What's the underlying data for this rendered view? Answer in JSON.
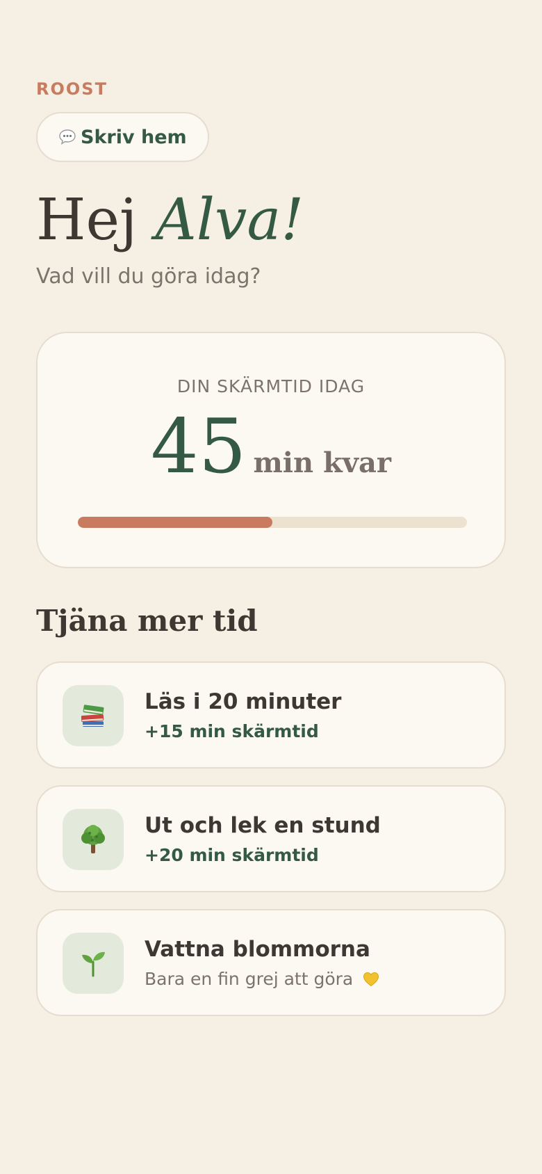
{
  "brand": "ROOST",
  "header": {
    "write_home_label": "Skriv hem"
  },
  "greeting": {
    "hello": "Hej",
    "name": "Alva!",
    "subtitle": "Vad vill du göra idag?"
  },
  "screen_time": {
    "label": "DIN SKÄRMTID IDAG",
    "value": "45",
    "unit": "min kvar",
    "progress_percent": 50
  },
  "earn": {
    "title": "Tjäna mer tid",
    "tasks": [
      {
        "icon": "books-icon",
        "title": "Läs i 20 minuter",
        "subtitle": "+15 min skärmtid"
      },
      {
        "icon": "tree-icon",
        "title": "Ut och lek en stund",
        "subtitle": "+20 min skärmtid"
      },
      {
        "icon": "seedling-icon",
        "title": "Vattna blommorna",
        "subtitle": "Bara en fin grej att göra"
      }
    ]
  },
  "colors": {
    "background": "#F5EFE4",
    "accent": "#C87B5E",
    "brand_green": "#355A43",
    "card": "#FCF8F2",
    "progress_track": "#EDE2CF",
    "icon_tile": "#E3EADB"
  }
}
